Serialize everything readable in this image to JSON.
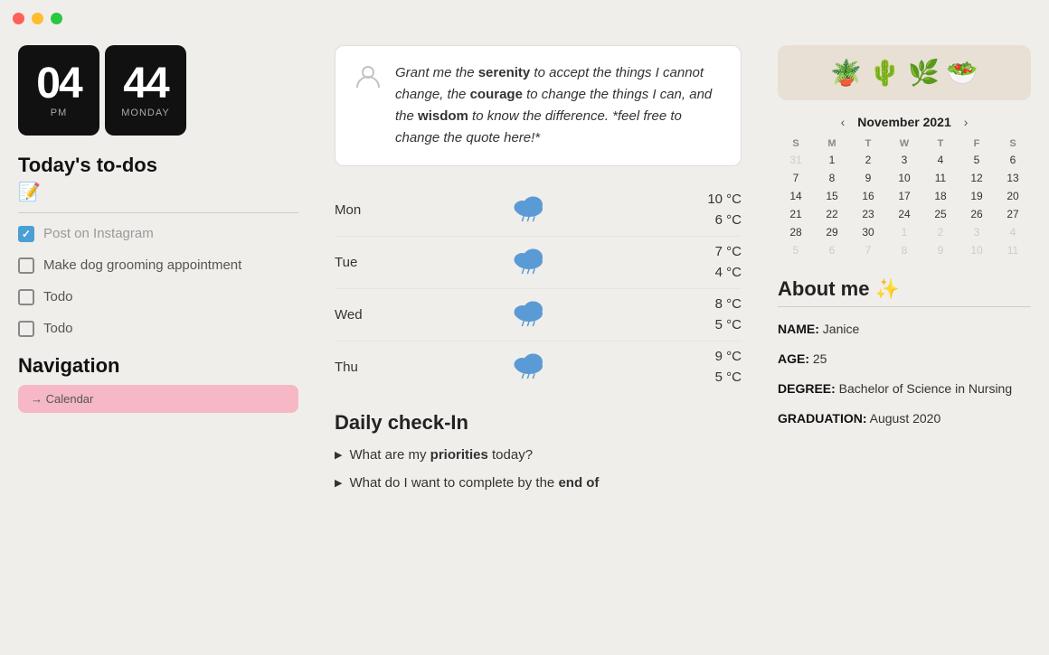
{
  "titlebar": {
    "dots": [
      "red",
      "yellow",
      "green"
    ]
  },
  "clock": {
    "hour": "04",
    "minute": "44",
    "period": "PM",
    "day": "MONDAY"
  },
  "todos": {
    "title": "Today's to-dos",
    "memo_icon": "📝",
    "items": [
      {
        "text": "Post on Instagram",
        "checked": true
      },
      {
        "text": "Make dog grooming appointment",
        "checked": false
      },
      {
        "text": "Todo",
        "checked": false
      },
      {
        "text": "Todo",
        "checked": false
      }
    ]
  },
  "navigation": {
    "title": "Navigation",
    "button_label": "→ Calendar"
  },
  "quote": {
    "icon": "👤",
    "text": "Grant me the serenity to accept the things I cannot change, the courage to change the things I can, and the wisdom to know the difference. *feel free to change the quote here!*"
  },
  "weather": {
    "days": [
      {
        "day": "Mon",
        "high": "10 °C",
        "low": "6 °C"
      },
      {
        "day": "Tue",
        "high": "7 °C",
        "low": "4 °C"
      },
      {
        "day": "Wed",
        "high": "8 °C",
        "low": "5 °C"
      },
      {
        "day": "Thu",
        "high": "9 °C",
        "low": "5 °C"
      }
    ]
  },
  "checkin": {
    "title": "Daily check-In",
    "items": [
      {
        "text_start": "What are my ",
        "bold": "priorities",
        "text_end": " today?"
      },
      {
        "text_start": "What do I want to complete by the ",
        "bold": "end of",
        "text_end": ""
      }
    ]
  },
  "plants": {
    "emojis": [
      "🪴",
      "🌵",
      "🌿",
      "🥗"
    ]
  },
  "calendar": {
    "month": "November 2021",
    "days_header": [
      "S",
      "M",
      "T",
      "W",
      "T",
      "F",
      "S"
    ],
    "weeks": [
      [
        "31",
        "1",
        "2",
        "3",
        "4",
        "5",
        "6"
      ],
      [
        "7",
        "8",
        "9",
        "10",
        "11",
        "12",
        "13"
      ],
      [
        "14",
        "15",
        "16",
        "17",
        "18",
        "19",
        "20"
      ],
      [
        "21",
        "22",
        "23",
        "24",
        "25",
        "26",
        "27"
      ],
      [
        "28",
        "29",
        "30",
        "1",
        "2",
        "3",
        "4"
      ],
      [
        "5",
        "6",
        "7",
        "8",
        "9",
        "10",
        "11"
      ]
    ],
    "other_month_first_row": [
      true,
      false,
      false,
      false,
      false,
      false,
      false
    ],
    "other_month_last_row": [
      false,
      false,
      false,
      true,
      true,
      true,
      true
    ],
    "other_month_last2_row": [
      false,
      false,
      false,
      false,
      false,
      false,
      false
    ]
  },
  "about": {
    "title": "About me ✨",
    "fields": [
      {
        "label": "NAME",
        "value": "Janice"
      },
      {
        "label": "AGE",
        "value": "25"
      },
      {
        "label": "DEGREE",
        "value": "Bachelor of Science in Nursing"
      },
      {
        "label": "GRADUATION",
        "value": "August 2020"
      }
    ]
  }
}
